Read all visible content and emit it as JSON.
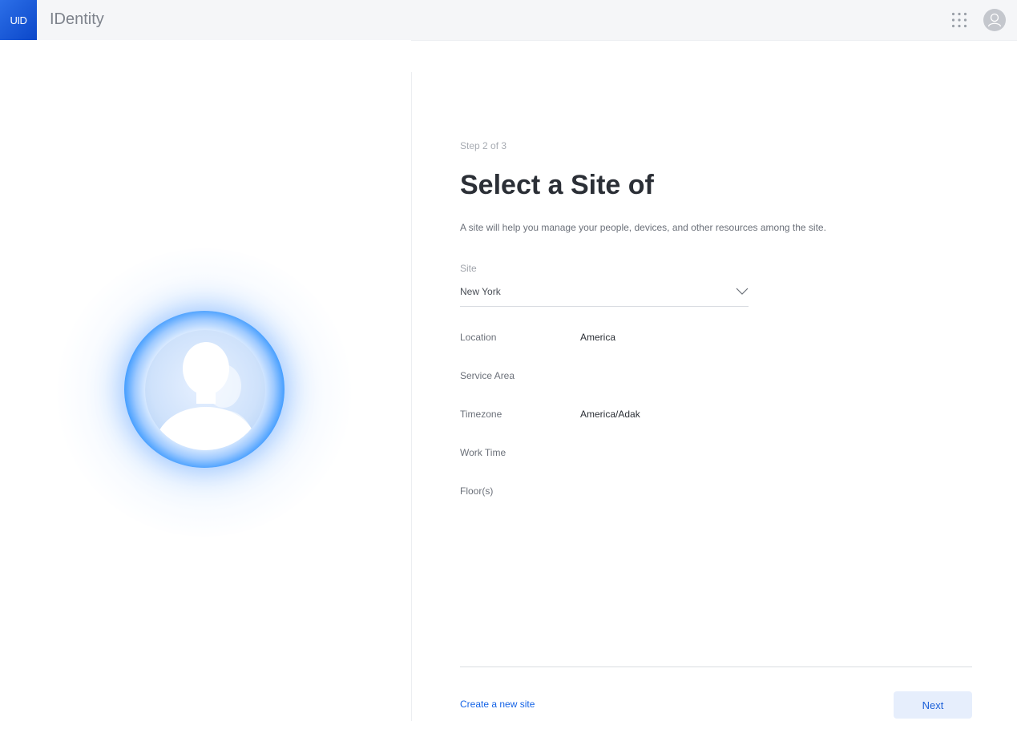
{
  "header": {
    "logo_text": "UID",
    "app_title": "IDentity",
    "apps_icon": "grid-dots-icon",
    "avatar_icon": "user-avatar-icon"
  },
  "illustration": {
    "icon": "user-profile-glow-icon"
  },
  "form": {
    "step": "Step 2 of 3",
    "title": "Select a Site of",
    "description": "A site will help you manage your people, devices, and other resources among the site.",
    "site_label": "Site",
    "site_value": "New York",
    "details": [
      {
        "label": "Location",
        "value": "America"
      },
      {
        "label": "Service Area",
        "value": ""
      },
      {
        "label": "Timezone",
        "value": "America/Adak"
      },
      {
        "label": "Work Time",
        "value": ""
      },
      {
        "label": "Floor(s)",
        "value": ""
      }
    ]
  },
  "footer": {
    "create_link": "Create a new site",
    "next_label": "Next"
  },
  "colors": {
    "accent": "#1463e6",
    "brand": "#0b47c9",
    "button_bg": "#e6eefc"
  }
}
